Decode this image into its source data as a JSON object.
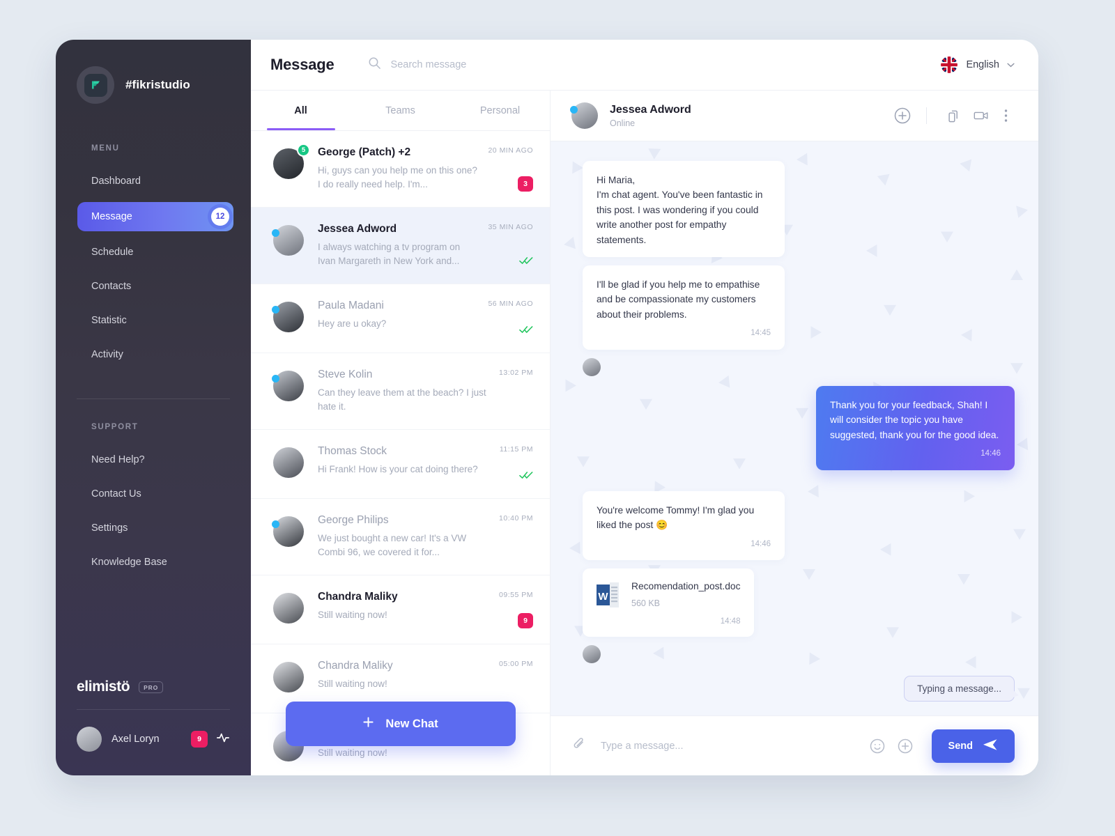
{
  "sidebar": {
    "brand": {
      "name": "#fikristudio",
      "logo_icon": "f-logo-icon"
    },
    "menu_label": "MENU",
    "menu_items": [
      {
        "label": "Dashboard",
        "active": false,
        "badge": ""
      },
      {
        "label": "Message",
        "active": true,
        "badge": "12"
      },
      {
        "label": "Schedule",
        "active": false,
        "badge": ""
      },
      {
        "label": "Contacts",
        "active": false,
        "badge": ""
      },
      {
        "label": "Statistic",
        "active": false,
        "badge": ""
      },
      {
        "label": "Activity",
        "active": false,
        "badge": ""
      }
    ],
    "support_label": "SUPPORT",
    "support_items": [
      {
        "label": "Need Help?"
      },
      {
        "label": "Contact Us"
      },
      {
        "label": "Settings"
      },
      {
        "label": "Knowledge Base"
      }
    ],
    "footer": {
      "workspace": "elimistö",
      "plan_badge": "PRO",
      "user_name": "Axel Loryn",
      "user_badge": "9",
      "activity_icon": "pulse-icon"
    }
  },
  "topbar": {
    "title": "Message",
    "search_placeholder": "Search message",
    "search_value": "",
    "language": "English",
    "flag_icon": "uk-flag-icon"
  },
  "tabs": [
    {
      "label": "All",
      "active": true
    },
    {
      "label": "Teams",
      "active": false
    },
    {
      "label": "Personal",
      "active": false
    }
  ],
  "conversations": [
    {
      "name": "George (Patch) +2",
      "snippet": "Hi, guys can you help me on this one? I do really need help. I'm...",
      "time": "20 MIN AGO",
      "unread": "3",
      "read_ticks": false,
      "online": false,
      "group_count": "5",
      "is_group": true,
      "bold": true,
      "selected": false
    },
    {
      "name": "Jessea Adword",
      "snippet": "I always watching  a tv program on Ivan Margareth in New York and...",
      "time": "35 MIN AGO",
      "unread": "",
      "read_ticks": true,
      "online": true,
      "is_group": false,
      "bold": true,
      "selected": true
    },
    {
      "name": "Paula Madani",
      "snippet": "Hey are u okay?",
      "time": "56 MIN AGO",
      "unread": "",
      "read_ticks": true,
      "online": true,
      "is_group": false,
      "bold": false,
      "selected": false
    },
    {
      "name": "Steve Kolin",
      "snippet": "Can they leave them at the beach? I just hate it.",
      "time": "13:02 PM",
      "unread": "",
      "read_ticks": false,
      "online": true,
      "is_group": false,
      "bold": false,
      "selected": false
    },
    {
      "name": "Thomas Stock",
      "snippet": "Hi Frank! How is your cat doing there?",
      "time": "11:15 PM",
      "unread": "",
      "read_ticks": true,
      "online": false,
      "is_group": false,
      "bold": false,
      "selected": false
    },
    {
      "name": "George Philips",
      "snippet": "We just bought a new car! It's a VW Combi 96, we covered it for...",
      "time": "10:40 PM",
      "unread": "",
      "read_ticks": false,
      "online": true,
      "is_group": false,
      "bold": false,
      "selected": false
    },
    {
      "name": "Chandra Maliky",
      "snippet": "Still waiting now!",
      "time": "09:55 PM",
      "unread": "9",
      "read_ticks": false,
      "online": false,
      "is_group": false,
      "bold": true,
      "selected": false
    },
    {
      "name": "Chandra Maliky",
      "snippet": "Still waiting now!",
      "time": "05:00 PM",
      "unread": "",
      "read_ticks": false,
      "online": false,
      "is_group": false,
      "bold": false,
      "selected": false
    }
  ],
  "new_chat_button": {
    "label": "New Chat",
    "icon": "plus-icon"
  },
  "chat_header": {
    "name": "Jessea Adword",
    "status": "Online",
    "actions": [
      "plus-circle-icon",
      "devices-icon",
      "video-camera-icon",
      "more-vertical-icon"
    ]
  },
  "messages": [
    {
      "side": "in",
      "type": "text",
      "text": "Hi Maria,\nI'm chat agent. You've been fantastic in this post. I was wondering if you could write another post for empathy statements.",
      "time": ""
    },
    {
      "side": "in",
      "type": "text",
      "text": "I'll be glad if you help me to empathise and be compassionate my customers about their problems.",
      "time": "14:45"
    },
    {
      "side": "in",
      "type": "avatar"
    },
    {
      "side": "out",
      "type": "text",
      "text": "Thank you for your feedback, Shah! I will consider the topic you have suggested, thank you for the good idea.",
      "time": "14:46"
    },
    {
      "side": "in",
      "type": "text",
      "text": "You're welcome Tommy! I'm glad you liked the post 😊",
      "time": "14:46"
    },
    {
      "side": "in",
      "type": "file",
      "file_name": "Recomendation_post.doc",
      "file_size": "560 KB",
      "file_icon": "word-doc-icon",
      "time": "14:48"
    },
    {
      "side": "in",
      "type": "avatar"
    }
  ],
  "typing_indicator": "Typing a message...",
  "composer": {
    "attach_icon": "paperclip-icon",
    "placeholder": "Type a message...",
    "value": "",
    "emoji_icon": "smiley-icon",
    "add_icon": "plus-circle-icon",
    "send_label": "Send",
    "send_icon": "send-arrow-icon"
  },
  "colors": {
    "accent": "#5c6bf0",
    "tab_underline": "#8b5cf6",
    "unread_badge": "#ec1e63",
    "online": "#29b6f6",
    "read_tick": "#22c55e",
    "brand_logo": "#24b694",
    "page_bg": "#e4eaf1",
    "chat_bg": "#f3f6fd"
  }
}
